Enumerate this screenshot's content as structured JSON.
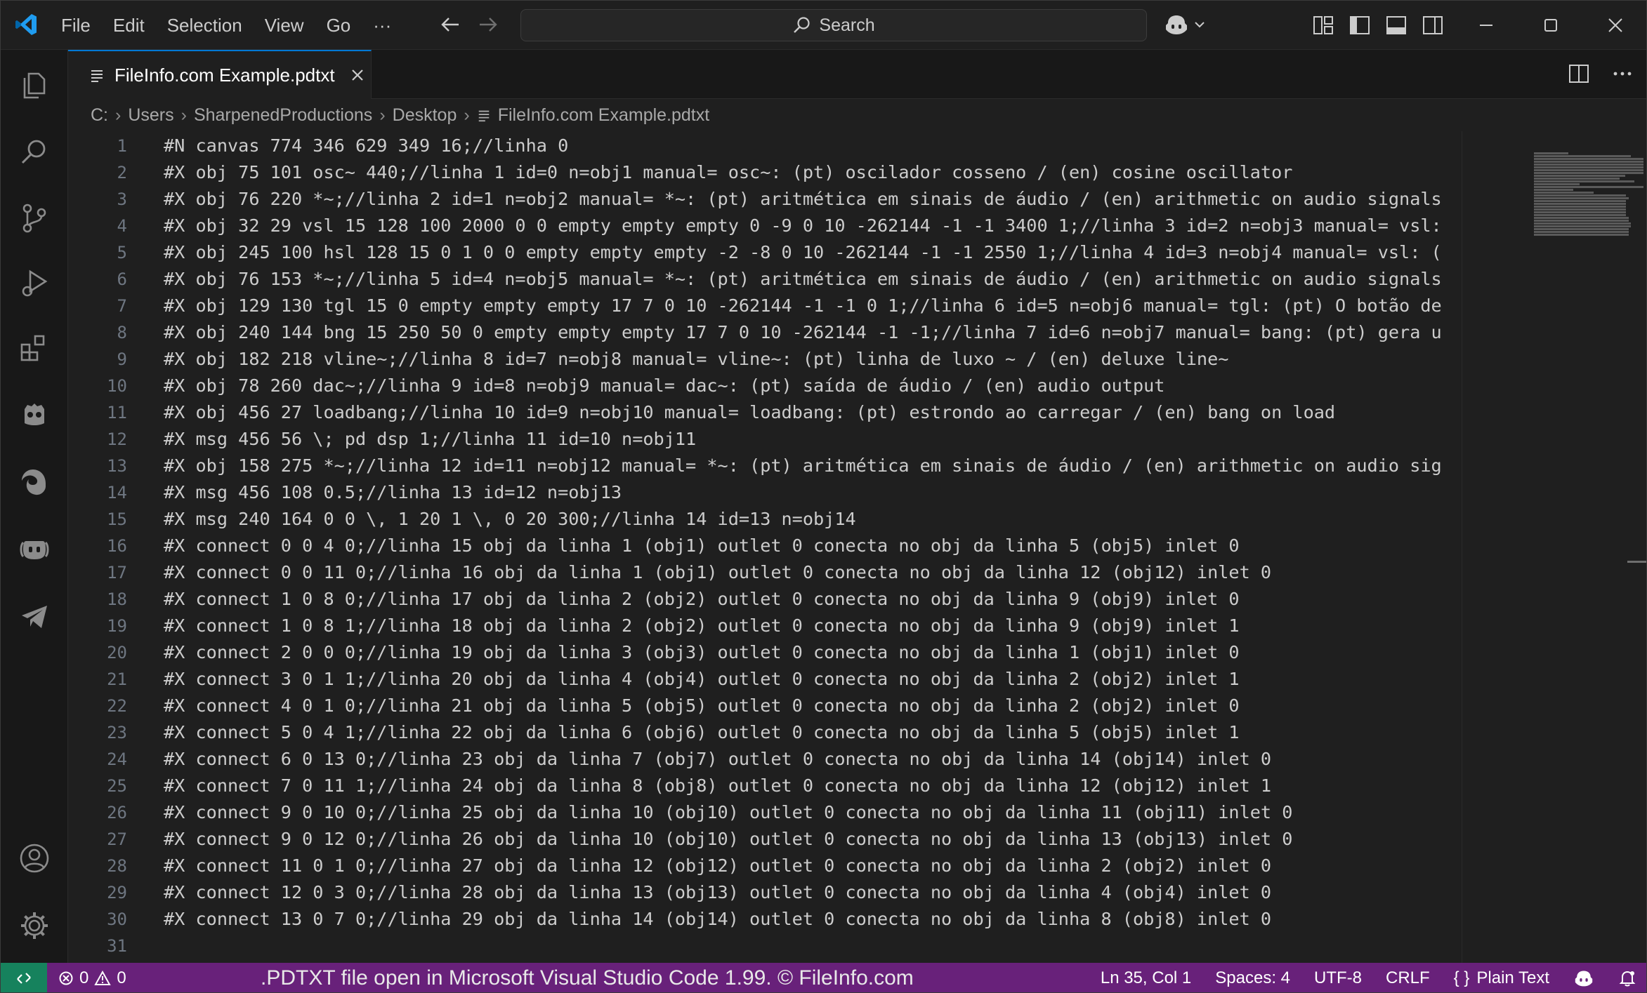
{
  "menu": [
    "File",
    "Edit",
    "Selection",
    "View",
    "Go",
    "···"
  ],
  "search": {
    "label": "Search"
  },
  "tab": {
    "label": "FileInfo.com Example.pdtxt",
    "close": "×"
  },
  "breadcrumb": [
    "C:",
    "Users",
    "SharpenedProductions",
    "Desktop",
    "FileInfo.com Example.pdtxt"
  ],
  "editor": {
    "lines": [
      "#N canvas 774 346 629 349 16;//linha 0",
      "#X obj 75 101 osc~ 440;//linha 1 id=0 n=obj1 manual= osc~: (pt) oscilador cosseno / (en) cosine oscillator",
      "#X obj 76 220 *~;//linha 2 id=1 n=obj2 manual= *~: (pt) aritmética em sinais de áudio / (en) arithmetic on audio signals",
      "#X obj 32 29 vsl 15 128 100 2000 0 0 empty empty empty 0 -9 0 10 -262144 -1 -1 3400 1;//linha 3 id=2 n=obj3 manual= vsl:",
      "#X obj 245 100 hsl 128 15 0 1 0 0 empty empty empty -2 -8 0 10 -262144 -1 -1 2550 1;//linha 4 id=3 n=obj4 manual= vsl: (",
      "#X obj 76 153 *~;//linha 5 id=4 n=obj5 manual= *~: (pt) aritmética em sinais de áudio / (en) arithmetic on audio signals",
      "#X obj 129 130 tgl 15 0 empty empty empty 17 7 0 10 -262144 -1 -1 0 1;//linha 6 id=5 n=obj6 manual= tgl: (pt) O botão de",
      "#X obj 240 144 bng 15 250 50 0 empty empty empty 17 7 0 10 -262144 -1 -1;//linha 7 id=6 n=obj7 manual= bang: (pt) gera u",
      "#X obj 182 218 vline~;//linha 8 id=7 n=obj8 manual= vline~: (pt) linha de luxo ~ / (en) deluxe line~",
      "#X obj 78 260 dac~;//linha 9 id=8 n=obj9 manual= dac~: (pt) saída de áudio / (en) audio output",
      "#X obj 456 27 loadbang;//linha 10 id=9 n=obj10 manual= loadbang: (pt) estrondo ao carregar / (en) bang on load",
      "#X msg 456 56 \\; pd dsp 1;//linha 11 id=10 n=obj11",
      "#X obj 158 275 *~;//linha 12 id=11 n=obj12 manual= *~: (pt) aritmética em sinais de áudio / (en) arithmetic on audio sig",
      "#X msg 456 108 0.5;//linha 13 id=12 n=obj13",
      "#X msg 240 164 0 0 \\, 1 20 1 \\, 0 20 300;//linha 14 id=13 n=obj14",
      "#X connect 0 0 4 0;//linha 15 obj da linha 1 (obj1) outlet 0 conecta no obj da linha 5 (obj5) inlet 0",
      "#X connect 0 0 11 0;//linha 16 obj da linha 1 (obj1) outlet 0 conecta no obj da linha 12 (obj12) inlet 0",
      "#X connect 1 0 8 0;//linha 17 obj da linha 2 (obj2) outlet 0 conecta no obj da linha 9 (obj9) inlet 0",
      "#X connect 1 0 8 1;//linha 18 obj da linha 2 (obj2) outlet 0 conecta no obj da linha 9 (obj9) inlet 1",
      "#X connect 2 0 0 0;//linha 19 obj da linha 3 (obj3) outlet 0 conecta no obj da linha 1 (obj1) inlet 0",
      "#X connect 3 0 1 1;//linha 20 obj da linha 4 (obj4) outlet 0 conecta no obj da linha 2 (obj2) inlet 1",
      "#X connect 4 0 1 0;//linha 21 obj da linha 5 (obj5) outlet 0 conecta no obj da linha 2 (obj2) inlet 0",
      "#X connect 5 0 4 1;//linha 22 obj da linha 6 (obj6) outlet 0 conecta no obj da linha 5 (obj5) inlet 1",
      "#X connect 6 0 13 0;//linha 23 obj da linha 7 (obj7) outlet 0 conecta no obj da linha 14 (obj14) inlet 0",
      "#X connect 7 0 11 1;//linha 24 obj da linha 8 (obj8) outlet 0 conecta no obj da linha 12 (obj12) inlet 1",
      "#X connect 9 0 10 0;//linha 25 obj da linha 10 (obj10) outlet 0 conecta no obj da linha 11 (obj11) inlet 0",
      "#X connect 9 0 12 0;//linha 26 obj da linha 10 (obj10) outlet 0 conecta no obj da linha 13 (obj13) inlet 0",
      "#X connect 11 0 1 0;//linha 27 obj da linha 12 (obj12) outlet 0 conecta no obj da linha 2 (obj2) inlet 0",
      "#X connect 12 0 3 0;//linha 28 obj da linha 13 (obj13) outlet 0 conecta no obj da linha 4 (obj4) inlet 0",
      "#X connect 13 0 7 0;//linha 29 obj da linha 14 (obj14) outlet 0 conecta no obj da linha 8 (obj8) inlet 0",
      ""
    ]
  },
  "statusbar": {
    "errors": "0",
    "warnings": "0",
    "watermark": ".PDTXT file open in Microsoft Visual Studio Code 1.99. © FileInfo.com",
    "position": "Ln 35, Col 1",
    "spaces": "Spaces: 4",
    "encoding": "UTF-8",
    "eol": "CRLF",
    "language": "Plain Text"
  },
  "colors": {
    "statusbar": "#68217a",
    "remote": "#16825d",
    "accent": "#0078d4",
    "editor_bg": "#1f1f1f"
  },
  "icons": [
    "vscode-logo-icon",
    "arrow-left-icon",
    "arrow-right-icon",
    "search-icon",
    "copilot-icon",
    "chevron-down-icon",
    "customize-layout-icon",
    "toggle-primary-sidebar-icon",
    "toggle-panel-icon",
    "toggle-secondary-sidebar-icon",
    "minimize-icon",
    "maximize-icon",
    "close-icon",
    "explorer-icon",
    "search-icon",
    "source-control-icon",
    "run-debug-icon",
    "extensions-icon",
    "godot-icon",
    "edge-icon",
    "github-copilot-icon",
    "telegram-icon",
    "account-icon",
    "settings-gear-icon",
    "file-text-icon",
    "split-editor-icon",
    "more-actions-icon",
    "remote-icon",
    "error-icon",
    "warning-icon",
    "braces-icon",
    "bell-icon"
  ]
}
